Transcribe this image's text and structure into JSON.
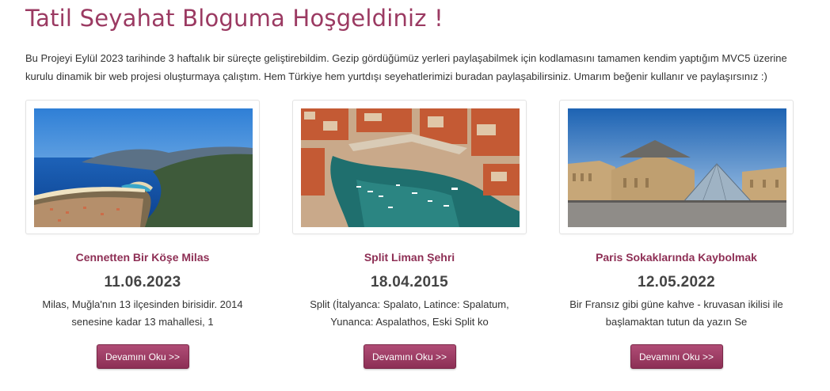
{
  "header": {
    "title": "Tatil Seyahat Bloguma Hoşgeldiniz !",
    "intro": "Bu Projeyi Eylül 2023 tarihinde 3 haftalık bir süreçte geliştirebildim. Gezip gördüğümüz yerleri paylaşabilmek için kodlamasını tamamen kendim yaptığım MVC5 üzerine kurulu dinamik bir web projesi oluşturmaya çalıştım. Hem Türkiye hem yurtdışı seyehatlerimizi buradan paylaşabilirsiniz. Umarım beğenir kullanır ve paylaşırsınız :)"
  },
  "posts": [
    {
      "title": "Cennetten Bir Köşe Milas",
      "date": "11.06.2023",
      "excerpt": "Milas, Muğla'nın 13 ilçesinden birisidir. 2014 senesine kadar 13 mahallesi, 1",
      "button": "Devamını Oku >>",
      "image": "coastal-lagoon-photo"
    },
    {
      "title": "Split Liman Şehri",
      "date": "18.04.2015",
      "excerpt": "Split (İtalyanca: Spalato, Latince: Spalatum, Yunanca: Aspalathos, Eski Split ko",
      "button": "Devamını Oku >>",
      "image": "harbor-city-photo"
    },
    {
      "title": "Paris Sokaklarında Kaybolmak",
      "date": "12.05.2022",
      "excerpt": "Bir Fransız gibi güne kahve - kruvasan ikilisi ile başlamaktan tutun da yazın Se",
      "button": "Devamını Oku >>",
      "image": "louvre-pyramid-photo"
    }
  ],
  "colors": {
    "accent": "#9b3a62",
    "button": "#8c2f55"
  }
}
